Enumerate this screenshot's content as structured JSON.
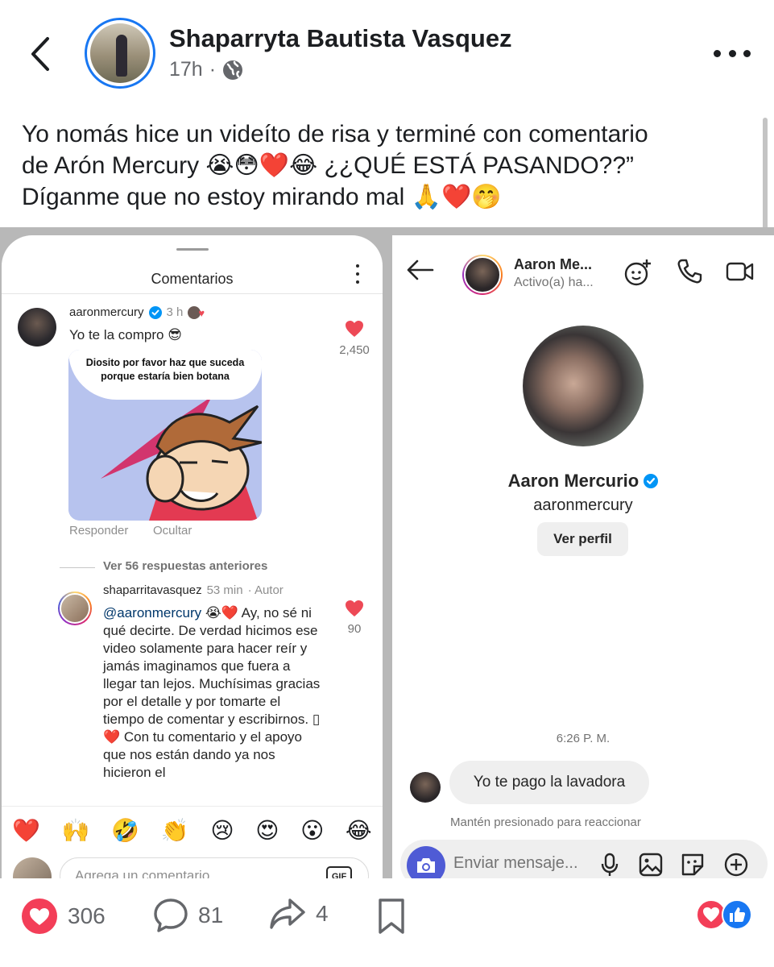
{
  "post": {
    "author": "Shaparryta Bautista Vasquez",
    "time": "17h",
    "dot": "·",
    "text_lines": [
      "Yo nomás hice un videíto de risa y terminé con comentario",
      "de Arón Mercury 😭😳❤️😂 ¿¿QUÉ ESTÁ PASANDO??”",
      "Díganme que no estoy mirando mal 🙏❤️🤭"
    ]
  },
  "ig_comments": {
    "title": "Comentarios",
    "comment1": {
      "user": "aaronmercury",
      "time": "3 h",
      "text": "Yo te la compro 😎",
      "likes": "2,450",
      "meme_caption": "Diosito por favor haz que suceda porque estaría bien botana",
      "reply_label": "Responder",
      "hide_label": "Ocultar"
    },
    "view_replies": "Ver 56 respuestas anteriores",
    "reply": {
      "user": "shaparritavasquez",
      "time": "53 min",
      "author_badge": "· Autor",
      "mention": "@aaronmercury",
      "text": " 😭❤️ Ay, no sé ni qué decirte. De verdad hicimos ese video solamente para hacer reír y jamás imaginamos que fuera a llegar tan lejos. Muchísimas gracias por el detalle y por tomarte el tiempo de comentar y escribirnos. ▯❤️ Con tu comentario y el apoyo que nos están dando ya nos hicieron el",
      "likes": "90"
    },
    "emoji_bar": [
      "❤️",
      "🙌",
      "🤣",
      "👏",
      "😢",
      "😍",
      "😮",
      "😂"
    ],
    "input_placeholder": "Agrega un comentario...",
    "gif_label": "GIF"
  },
  "ig_dm": {
    "header_name": "Aaron Me...",
    "header_status": "Activo(a) ha...",
    "profile_name": "Aaron Mercurio",
    "profile_user": "aaronmercury",
    "view_profile": "Ver perfil",
    "time": "6:26 P. M.",
    "message": "Yo te pago la lavadora",
    "hint": "Mantén presionado para reaccionar",
    "input_placeholder": "Enviar mensaje..."
  },
  "actions": {
    "reactions": "306",
    "comments": "81",
    "shares": "4"
  },
  "colors": {
    "fb_blue": "#1877f2",
    "ig_heart": "#ed4956",
    "love_red": "#f33e58",
    "verified": "#0095f6"
  }
}
